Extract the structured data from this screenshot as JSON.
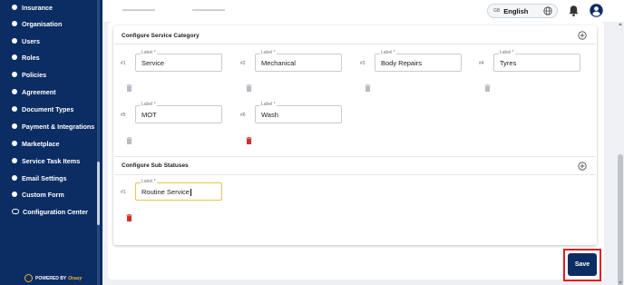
{
  "sidebar": {
    "items": [
      {
        "label": "Insurance",
        "icon": "dot-icon"
      },
      {
        "label": "Organisation",
        "icon": "dot-icon"
      },
      {
        "label": "Users",
        "icon": "dot-icon"
      },
      {
        "label": "Roles",
        "icon": "dot-icon"
      },
      {
        "label": "Policies",
        "icon": "dot-icon"
      },
      {
        "label": "Agreement",
        "icon": "dot-icon"
      },
      {
        "label": "Document Types",
        "icon": "dot-icon"
      },
      {
        "label": "Payment & Integrations",
        "icon": "dot-icon"
      },
      {
        "label": "Marketplace",
        "icon": "dot-icon"
      },
      {
        "label": "Service Task Items",
        "icon": "dot-icon"
      },
      {
        "label": "Email Settings",
        "icon": "dot-icon"
      },
      {
        "label": "Custom Form",
        "icon": "dot-icon"
      },
      {
        "label": "Configuration Center",
        "icon": "toggle-icon"
      }
    ],
    "powered_by": "POWERED BY",
    "powered_brand": "Onaxy"
  },
  "header": {
    "language_code": "GB",
    "language": "English"
  },
  "service_category": {
    "title": "Configure Service Category",
    "field_label": "Label *",
    "items": [
      {
        "index": "#1",
        "value": "Service",
        "delete_enabled": false
      },
      {
        "index": "#2",
        "value": "Mechanical",
        "delete_enabled": false
      },
      {
        "index": "#3",
        "value": "Body Repairs",
        "delete_enabled": false
      },
      {
        "index": "#4",
        "value": "Tyres",
        "delete_enabled": false
      },
      {
        "index": "#5",
        "value": "MOT",
        "delete_enabled": false
      },
      {
        "index": "#6",
        "value": "Wash",
        "delete_enabled": true
      }
    ]
  },
  "sub_statuses": {
    "title": "Configure Sub Statuses",
    "field_label": "Label *",
    "items": [
      {
        "index": "#1",
        "value": "Routine Service",
        "delete_enabled": true
      }
    ]
  },
  "actions": {
    "save_label": "Save"
  },
  "colors": {
    "sidebar_bg": "#0b2d63",
    "accent": "#0b2d63",
    "delete_active": "#d32f2f",
    "delete_disabled": "#b8bcc2",
    "highlight": "#e01b24"
  }
}
